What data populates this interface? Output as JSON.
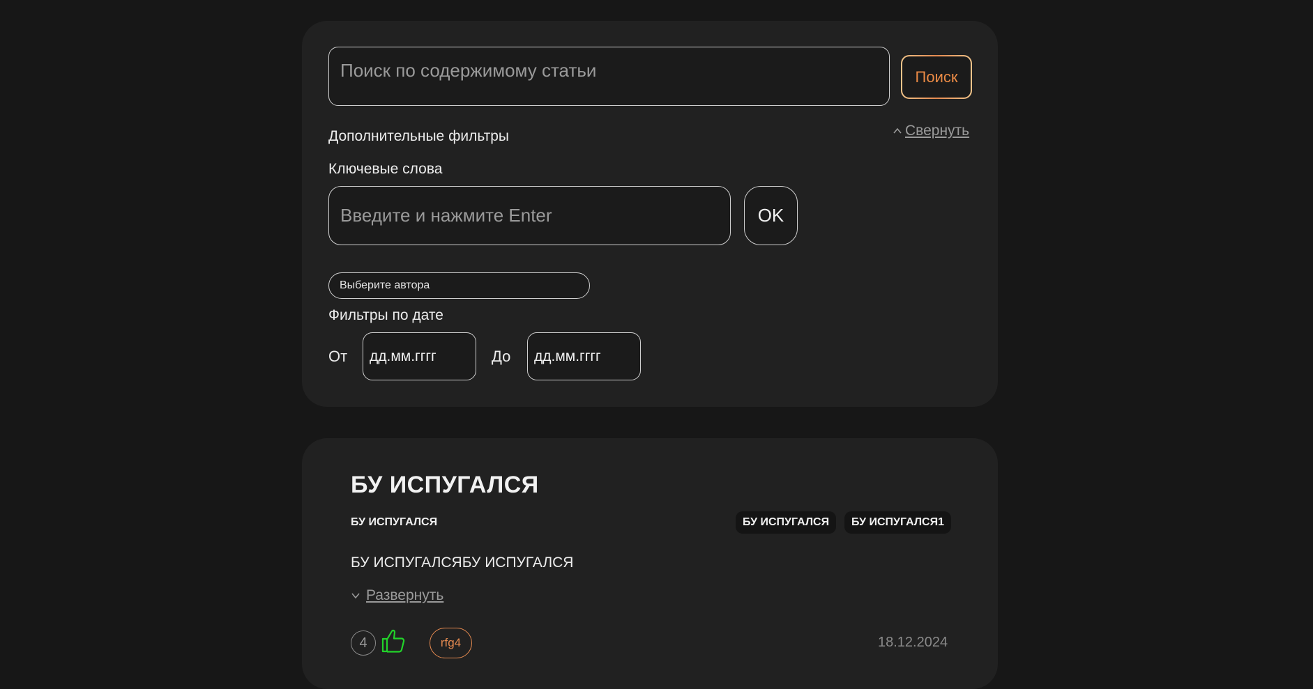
{
  "search": {
    "placeholder": "Поиск по содержимому статьи",
    "button_label": "Поиск",
    "accent_color": "#e58a50"
  },
  "filters": {
    "title": "Дополнительные фильтры",
    "collapse_label": "Свернуть",
    "keywords_label": "Ключевые слова",
    "keywords_placeholder": "Введите и нажмите Enter",
    "ok_label": "OK",
    "author_placeholder": "Выберите автора",
    "date_title": "Фильтры по дате",
    "from_label": "От",
    "to_label": "До",
    "date_placeholder_from": "дд.мм.гггг",
    "date_placeholder_to": "дд.мм.гггг"
  },
  "article": {
    "title": "БУ ИСПУГАЛСЯ",
    "author": "БУ ИСПУГАЛСЯ",
    "tags": [
      "БУ ИСПУГАЛСЯ",
      "БУ ИСПУГАЛСЯ1"
    ],
    "text": "БУ ИСПУГАЛСЯБУ ИСПУГАЛСЯ",
    "expand_label": "Развернуть",
    "likes": "4",
    "like_icon": "thumbs-up-icon",
    "like_color": "#22d32a",
    "user_badge": "rfg4",
    "date": "18.12.2024"
  }
}
